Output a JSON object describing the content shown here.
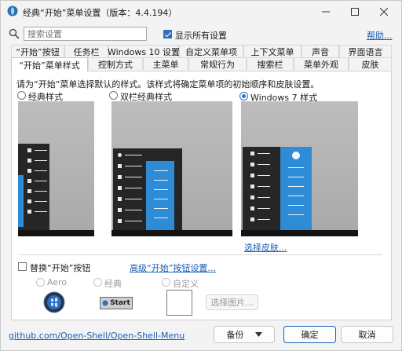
{
  "window": {
    "title": "经典“开始”菜单设置（版本：4.4.194）",
    "minimize_icon": "minimize-icon",
    "maximize_icon": "maximize-icon",
    "close_icon": "close-icon"
  },
  "search": {
    "placeholder": "搜索设置",
    "icon": "search-icon"
  },
  "show_all": {
    "label": "显示所有设置",
    "checked": true
  },
  "help_link": "帮助...",
  "tabs_row1": [
    "“开始”按钮",
    "任务栏",
    "Windows 10 设置",
    "自定义菜单项",
    "上下文菜单",
    "声音",
    "界面语言"
  ],
  "tabs_row2": [
    "“开始”菜单样式",
    "控制方式",
    "主菜单",
    "常规行为",
    "搜索栏",
    "菜单外观",
    "皮肤"
  ],
  "active_tab": "“开始”菜单样式",
  "panel": {
    "instruction": "请为“开始”菜单选择默认的样式。该样式将确定菜单项的初始顺序和皮肤设置。",
    "styles": [
      {
        "label": "经典样式",
        "selected": false
      },
      {
        "label": "双栏经典样式",
        "selected": false
      },
      {
        "label": "Windows 7 样式",
        "selected": true
      }
    ],
    "select_skin_link": "选择皮肤...",
    "replace_button": {
      "label": "替换“开始”按钮",
      "checked": false
    },
    "advanced_link": "高级“开始”按钮设置...",
    "button_styles": [
      {
        "label": "Aero",
        "selected": true
      },
      {
        "label": "经典",
        "selected": false
      },
      {
        "label": "自定义",
        "selected": false
      }
    ],
    "classic_button_text": "Start",
    "pick_image_button": "选择图片..."
  },
  "footer": {
    "link": "github.com/Open-Shell/Open-Shell-Menu",
    "backup": "备份",
    "ok": "确定",
    "cancel": "取消"
  },
  "colors": {
    "accent": "#2f6fc0",
    "menu_blue": "#2e8bd6",
    "menu_dark": "#262626",
    "link": "#1a5fb4"
  }
}
